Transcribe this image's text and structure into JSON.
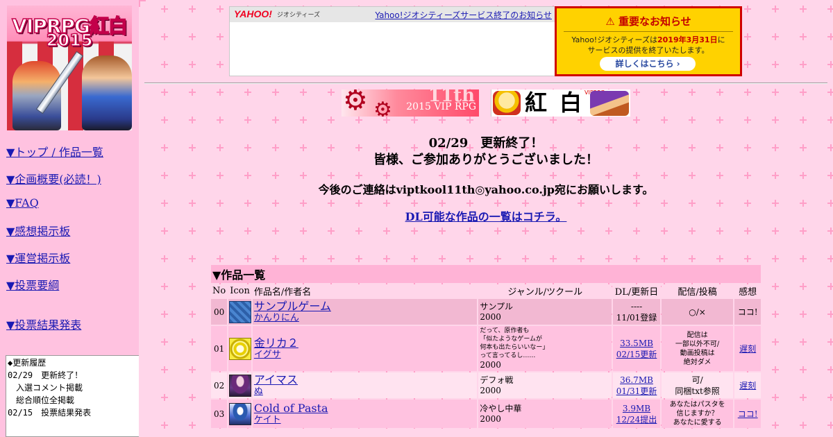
{
  "sidebar": {
    "logo_line1": "VIPRPG紅白",
    "logo_line2": "2015",
    "links": [
      "▼トップ / 作品一覧",
      "▼企画概要(必読！)",
      "▼FAQ",
      "▼感想掲示板",
      "▼運営掲示板",
      "▼投票要綱",
      "▼投票結果発表"
    ],
    "history": {
      "title": "◆更新履歴",
      "lines": [
        "02/29　更新終了！",
        "　入選コメント掲載",
        "　総合順位全掲載",
        "02/15　投票結果発表"
      ]
    }
  },
  "yahoo": {
    "logo": "YAHOO!",
    "logo_sub": "ジオシティーズ",
    "notice_link": "Yahoo!ジオシティーズサービス終了のお知らせ"
  },
  "important": {
    "title": "⚠ 重要なお知らせ",
    "body_pre": "Yahoo!ジオシティーズは",
    "body_date": "2019年3月31日",
    "body_post": "に\nサービスの提供を終了いたします。",
    "button": "詳しくはこちら ›"
  },
  "banners": {
    "vip_big": "11th",
    "vip_sub": "2015 VIP RPG",
    "kouhaku_k": "紅",
    "kouhaku_h": "白",
    "kouhaku_tag": "VIPRPG"
  },
  "announcement": {
    "line1": "02/29　更新終了！",
    "line2": "皆様、ご参加ありがとうございました！",
    "line3": "今後のご連絡はviptkool11th◎yahoo.co.jp宛にお願いします。",
    "line4": "DL可能な作品の一覧はコチラ。"
  },
  "works": {
    "caption": "▼作品一覧",
    "headers": [
      "No",
      "Icon",
      "作品名/作者名",
      "ジャンル/ツクール",
      "DL/更新日",
      "配信/投稿",
      "感想"
    ],
    "rows": [
      {
        "no": "00",
        "icon": "blue-tile-icon",
        "title": "サンプルゲーム",
        "author": "かんりにん",
        "genre": "サンプル",
        "tool": "2000",
        "dl_size": "----",
        "dl_date": "11/01登録",
        "dist": "○/×",
        "impression": "ココ!"
      },
      {
        "no": "01",
        "icon": "gold-circle-icon",
        "title": "金リカ２",
        "author": "イグサ",
        "genre_note": "だって、原作者も\n「似たようなゲームが\n何本も出たらいいなー」\nって言ってるし……",
        "tool": "2000",
        "dl_size": "33.5MB",
        "dl_date": "02/15更新",
        "dist_note": "配信は\n一部以外不可/\n動画投稿は\n絶対ダメ",
        "impression": "遅刻"
      },
      {
        "no": "02",
        "icon": "dark-character-icon",
        "title": "アイマス",
        "author": "ぬ",
        "genre": "デフォ戦",
        "tool": "2000",
        "dl_size": "36.7MB",
        "dl_date": "01/31更新",
        "dist": "可/",
        "dist2": "同梱txt参照",
        "impression": "遅刻"
      },
      {
        "no": "03",
        "icon": "pixel-character-icon",
        "title": "Cold  of  Pasta",
        "author": "ケイト",
        "genre": "冷やし中華",
        "tool": "2000",
        "dl_size": "3.9MB",
        "dl_date": "12/24提出",
        "dist_note": "あなたはパスタを\n信じますか？\nあなたに愛する",
        "impression": "ココ!"
      }
    ]
  },
  "colors": {
    "page_bg": "#ffd6ea",
    "sidebar_bg": "#ffc2e0",
    "link": "#1a1ab3",
    "alert_red": "#c30000",
    "alert_yellow": "#ffd200"
  }
}
